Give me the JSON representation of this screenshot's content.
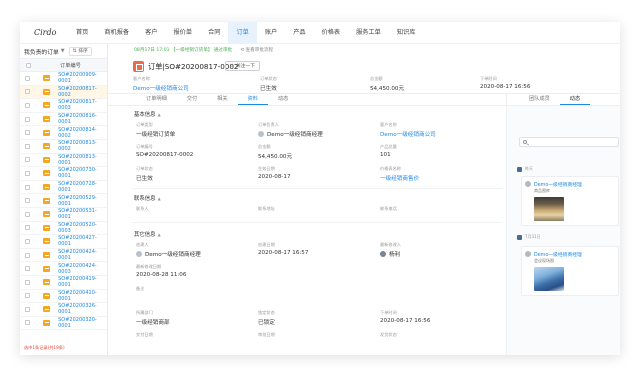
{
  "logo": "Cirdo",
  "nav": [
    "首页",
    "商机报备",
    "客户",
    "报价单",
    "合同",
    "订单",
    "账户",
    "产品",
    "价格表",
    "服务工单",
    "知识库"
  ],
  "nav_active": "订单",
  "left": {
    "title": "我负责的订单",
    "sort_label": "排序",
    "column_header": "订单编号",
    "rows": [
      "SO#20200909-0001",
      "SO#20200817-0002",
      "SO#20200817-0003",
      "SO#20200816-0001",
      "SO#20200814-0002",
      "SO#20200813-0002",
      "SO#20200813-0001",
      "SO#20200730-0001",
      "SO#20200728-0001",
      "SO#20200529-0001",
      "SO#20200531-0001",
      "SO#20200520-0003",
      "SO#20200427-0001",
      "SO#20200424-0001",
      "SO#20200424-0003",
      "SO#20200419-0001",
      "SO#20200410-0001",
      "SO#20200326-0001",
      "SO#20200320-0001"
    ],
    "selected_index": 1,
    "footer": "选中1条记录(共19条)"
  },
  "notice": {
    "text": "08月17日 17:01 【一级经销订货单】 通过审批",
    "action": "查看审批流程"
  },
  "header": {
    "title": "订单|SO#20200817-0002",
    "follow": "关注一下",
    "fields": [
      {
        "label": "客户名称",
        "value": "Demo一级经销商公司",
        "link": true
      },
      {
        "label": "订单状态",
        "value": "已生效",
        "link": false
      },
      {
        "label": "总金额",
        "value": "54,450.00元",
        "link": false
      },
      {
        "label": "下单时间",
        "value": "2020-08-17 16:56",
        "link": false
      }
    ]
  },
  "tabs": [
    "订单明细",
    "交付",
    "相关",
    "资料",
    "动态"
  ],
  "tabs_active": "资料",
  "right_tabs": [
    "团队成员",
    "动态"
  ],
  "right_tabs_active": "动态",
  "sections": {
    "basic": "基本信息",
    "contact": "联系信息",
    "other": "其它信息"
  },
  "fields": {
    "order_type_l": "订单类型",
    "order_type_v": "一级经销订货单",
    "owner_l": "订单负责人",
    "owner_v": "Demo一级经销商经理",
    "customer_l": "客户名称",
    "customer_v": "Demo一级经销商公司",
    "code_l": "订单编号",
    "code_v": "SO#20200817-0002",
    "total_l": "总金额",
    "total_v": "54,450.00元",
    "qty_l": "产品总量",
    "qty_v": "101",
    "status_l": "订单状态",
    "status_v": "已生效",
    "eff_l": "生效日期",
    "eff_v": "2020-08-17",
    "pricelist_l": "价格表名称",
    "pricelist_v": "一级经销商售价",
    "contact_l": "联系人",
    "addr_l": "联系地址",
    "phone_l": "联系电话",
    "creator_l": "创建人",
    "creator_v": "Demo一级经销商经理",
    "ctime_l": "创建日期",
    "ctime_v": "2020-08-17 16:57",
    "mod_l": "最新修改人",
    "mod_v": "杨利",
    "mtime_l": "最新修改日期",
    "mtime_v": "2020-08-28 11:06",
    "remark_l": "备注",
    "dept_l": "所属部门",
    "dept_v": "一级经销商部",
    "lock_l": "锁定状态",
    "lock_v": "已锁定",
    "otime_l": "下单时间",
    "otime_v": "2020-08-17 16:56",
    "x1_l": "交付日期",
    "x2_l": "审批日期",
    "x3_l": "发货状态"
  },
  "feed": [
    {
      "date": "昨天",
      "name": "Demo一级经销商经理",
      "sub": "商品图库"
    },
    {
      "date": "7月31日",
      "name": "Demo一级经销商经理",
      "sub": "会议现场图"
    }
  ]
}
